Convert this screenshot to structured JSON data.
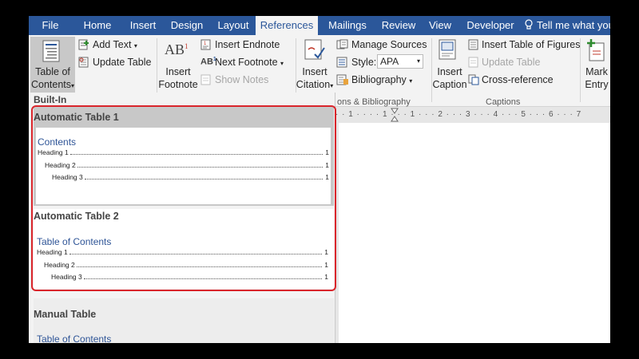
{
  "tabs": [
    "File",
    "Home",
    "Insert",
    "Design",
    "Layout",
    "References",
    "Mailings",
    "Review",
    "View",
    "Developer"
  ],
  "active_tab": "References",
  "tell_me": "Tell me what you",
  "ribbon": {
    "toc": {
      "label_line1": "Table of",
      "label_line2": "Contents"
    },
    "add_text": "Add Text",
    "update_table": "Update Table",
    "insert_footnote": {
      "line1": "Insert",
      "line2": "Footnote"
    },
    "footnote_icon_text": "AB",
    "insert_endnote": "Insert Endnote",
    "next_footnote": "Next Footnote",
    "show_notes": "Show Notes",
    "insert_citation": {
      "line1": "Insert",
      "line2": "Citation"
    },
    "manage_sources": "Manage Sources",
    "style_label": "Style:",
    "style_value": "APA",
    "bibliography": "Bibliography",
    "citations_group": "ons & Bibliography",
    "insert_caption": {
      "line1": "Insert",
      "line2": "Caption"
    },
    "insert_table_of_figures": "Insert Table of Figures",
    "update_table2": "Update Table",
    "cross_reference": "Cross-reference",
    "captions_group": "Captions",
    "mark_entry": {
      "line1": "Mark",
      "line2": "Entry"
    }
  },
  "ruler_text": "· · 1 · · · · 1 · · · 1 · · · 2 · · · 3 · · · 4 · · · 5 · · · 6 · · · 7",
  "gallery": {
    "section": "Built-In",
    "items": [
      {
        "title": "Automatic Table 1",
        "toc_heading": "Contents",
        "rows": [
          {
            "text": "Heading 1",
            "page": "1"
          },
          {
            "text": "Heading 2",
            "page": "1"
          },
          {
            "text": "Heading 3",
            "page": "1"
          }
        ]
      },
      {
        "title": "Automatic Table 2",
        "toc_heading": "Table of Contents",
        "rows": [
          {
            "text": "Heading 1",
            "page": "1"
          },
          {
            "text": "Heading 2",
            "page": "1"
          },
          {
            "text": "Heading 3",
            "page": "1"
          }
        ]
      },
      {
        "title": "Manual Table",
        "toc_heading": "Table of Contents"
      }
    ]
  },
  "colors": {
    "accent": "#2b579a",
    "highlight": "#d9252b",
    "toc_blue": "#2f5597"
  }
}
